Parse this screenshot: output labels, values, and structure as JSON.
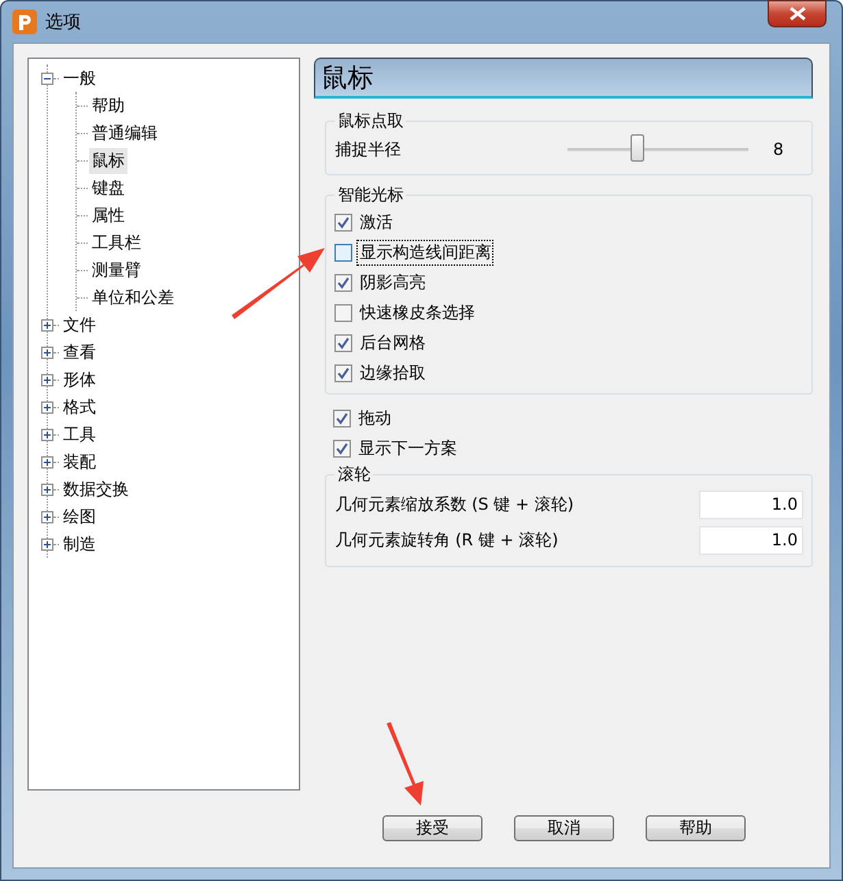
{
  "window": {
    "title": "选项"
  },
  "tree": [
    {
      "label": "一般",
      "expanded": true,
      "selected": false,
      "children": [
        {
          "label": "帮助",
          "selected": false
        },
        {
          "label": "普通编辑",
          "selected": false
        },
        {
          "label": "鼠标",
          "selected": true
        },
        {
          "label": "键盘",
          "selected": false
        },
        {
          "label": "属性",
          "selected": false
        },
        {
          "label": "工具栏",
          "selected": false
        },
        {
          "label": "测量臂",
          "selected": false
        },
        {
          "label": "单位和公差",
          "selected": false
        }
      ]
    },
    {
      "label": "文件",
      "expanded": false,
      "selected": false
    },
    {
      "label": "查看",
      "expanded": false,
      "selected": false
    },
    {
      "label": "形体",
      "expanded": false,
      "selected": false
    },
    {
      "label": "格式",
      "expanded": false,
      "selected": false
    },
    {
      "label": "工具",
      "expanded": false,
      "selected": false
    },
    {
      "label": "装配",
      "expanded": false,
      "selected": false
    },
    {
      "label": "数据交换",
      "expanded": false,
      "selected": false
    },
    {
      "label": "绘图",
      "expanded": false,
      "selected": false
    },
    {
      "label": "制造",
      "expanded": false,
      "selected": false
    }
  ],
  "page_title": "鼠标",
  "mouse_pick": {
    "title": "鼠标点取",
    "slider": {
      "label": "捕捉半径",
      "level": 0.38,
      "reading": "8"
    }
  },
  "smart_cursor": {
    "title": "智能光标",
    "options": [
      {
        "label": "激活",
        "checked": true,
        "focused": false
      },
      {
        "label": "显示构造线间距离",
        "checked": false,
        "focused": true
      },
      {
        "label": "阴影高亮",
        "checked": true,
        "focused": false
      },
      {
        "label": "快速橡皮条选择",
        "checked": false,
        "focused": false
      },
      {
        "label": "后台网格",
        "checked": true,
        "focused": false
      },
      {
        "label": "边缘拾取",
        "checked": true,
        "focused": false
      }
    ]
  },
  "options": [
    {
      "label": "拖动",
      "checked": true,
      "focused": false
    },
    {
      "label": "显示下一方案",
      "checked": true,
      "focused": false
    }
  ],
  "wheel": {
    "title": "滚轮",
    "fields": [
      {
        "label": "几何元素缩放系数 (S 键 + 滚轮)",
        "value": "1.0"
      },
      {
        "label": "几何元素旋转角 (R 键 + 滚轮)",
        "value": "1.0"
      }
    ]
  },
  "buttons": [
    "接受",
    "取消",
    "帮助"
  ]
}
